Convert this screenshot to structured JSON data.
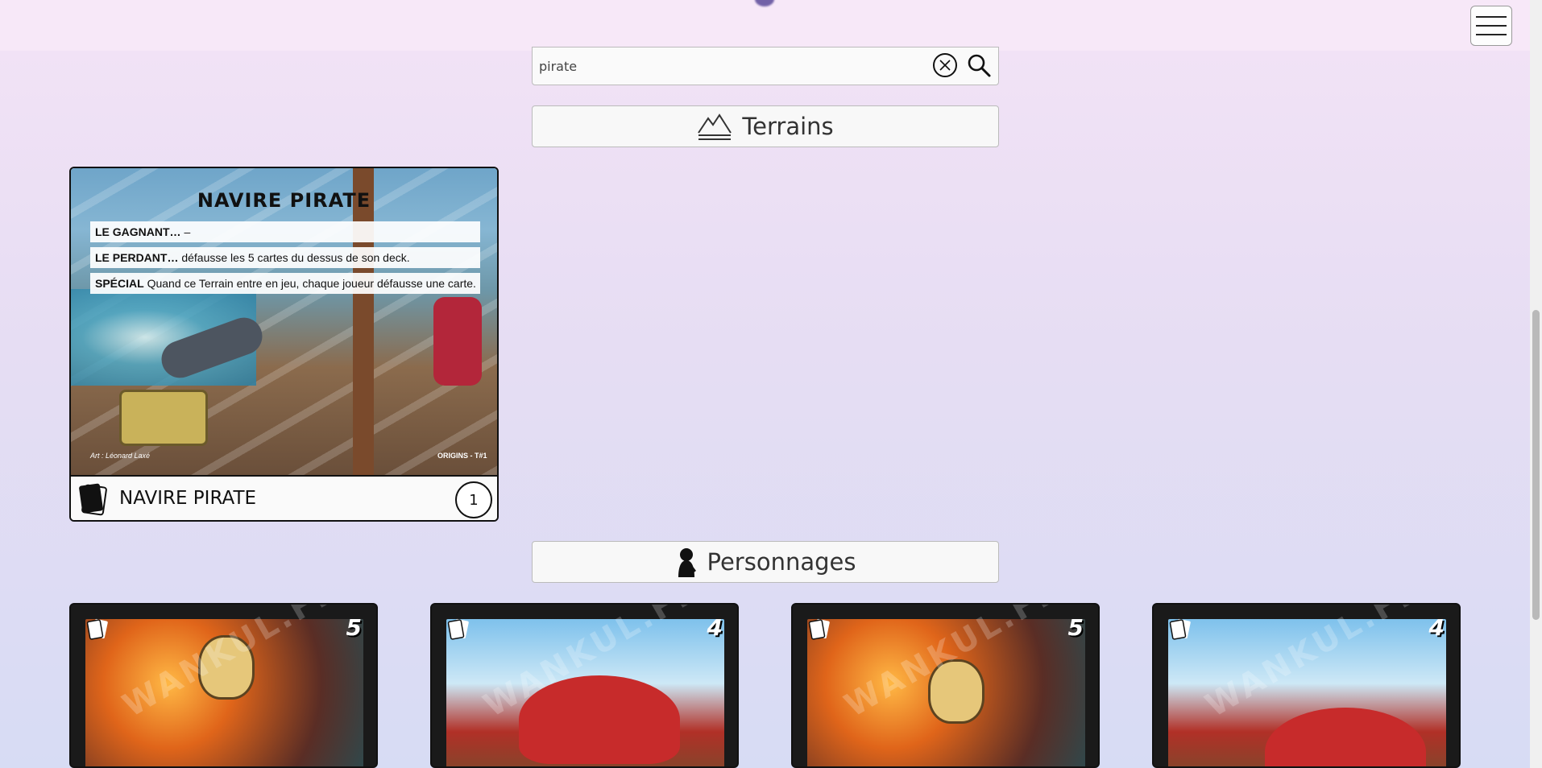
{
  "menu": {
    "icon": "hamburger-icon"
  },
  "search": {
    "value": "pirate",
    "clear_icon": "close-circle-icon",
    "search_icon": "search-icon"
  },
  "sections": {
    "terrains": {
      "label": "Terrains",
      "icon": "mountains-icon"
    },
    "personnages": {
      "label": "Personnages",
      "icon": "character-silhouette-icon"
    }
  },
  "terrain_card": {
    "art_title": "NAVIRE PIRATE",
    "rules": [
      {
        "key": "LE GAGNANT…",
        "text": " –"
      },
      {
        "key": "LE PERDANT…",
        "text": " défausse les 5 cartes du dessus de son deck."
      },
      {
        "key": "SPÉCIAL",
        "text": " Quand ce Terrain entre en jeu, chaque joueur défausse une carte."
      }
    ],
    "art_credit": "Art : Léonard Laxé",
    "set_code": "ORIGINS - T#1",
    "name": "NAVIRE PIRATE",
    "count": "1"
  },
  "character_cards": [
    {
      "cost": "5",
      "watermark": "WANKUL.FR",
      "art": "warm"
    },
    {
      "cost": "4",
      "watermark": "WANKUL.FR",
      "art": "sky"
    },
    {
      "cost": "5",
      "watermark": "WANKUL.FR",
      "art": "warm"
    },
    {
      "cost": "4",
      "watermark": "WANKUL.FR",
      "art": "sky"
    }
  ]
}
